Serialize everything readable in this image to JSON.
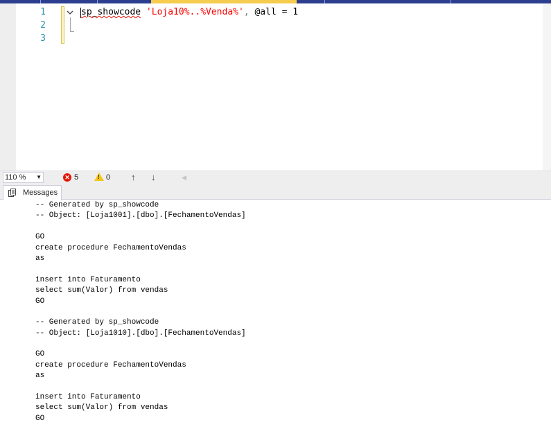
{
  "editor": {
    "line_numbers": [
      "1",
      "2",
      "3"
    ],
    "code": {
      "proc": "sp_showcode",
      "space1": " ",
      "string_literal": "'Loja10%..%Venda%'",
      "comma": ",",
      "rest": " @all = 1"
    },
    "collapse_icon": "chevron-down-icon"
  },
  "status_bar": {
    "zoom": "110 %",
    "error_count": "5",
    "warning_count": "0",
    "icons": [
      "error-icon",
      "warning-icon",
      "arrow-up-icon",
      "arrow-down-icon"
    ]
  },
  "results": {
    "tab_label": "Messages",
    "lines": [
      "-- Generated by sp_showcode",
      "-- Object: [Loja1001].[dbo].[FechamentoVendas]",
      "",
      "GO",
      "create procedure FechamentoVendas",
      "as",
      "",
      "insert into Faturamento",
      "select sum(Valor) from vendas",
      "GO",
      "",
      "-- Generated by sp_showcode",
      "-- Object: [Loja1010].[dbo].[FechamentoVendas]",
      "",
      "GO",
      "create procedure FechamentoVendas",
      "as",
      "",
      "insert into Faturamento",
      "select sum(Valor) from vendas",
      "GO"
    ]
  },
  "colors": {
    "tab_strip": "#2b3e8f",
    "active_tab": "#f5cc4d",
    "line_number": "#2b91af",
    "string": "#ff0000",
    "error": "#e51400"
  }
}
